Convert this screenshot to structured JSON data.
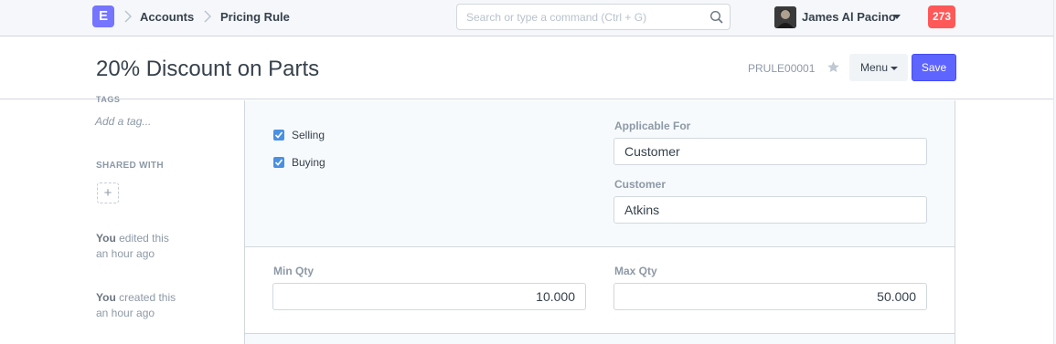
{
  "navbar": {
    "logo_letter": "E",
    "breadcrumbs": [
      "Accounts",
      "Pricing Rule"
    ],
    "search_placeholder": "Search or type a command (Ctrl + G)",
    "user_name": "James Al Pacino",
    "notification_count": "273"
  },
  "page_head": {
    "title": "20% Discount on Parts",
    "doc_name": "PRULE00001",
    "menu_label": "Menu",
    "save_label": "Save"
  },
  "sidebar": {
    "tags_label": "TAGS",
    "add_tag": "Add a tag...",
    "shared_with_label": "SHARED WITH",
    "share_add": "+",
    "activity": [
      {
        "actor": "You",
        "action": " edited this",
        "time": "an hour ago"
      },
      {
        "actor": "You",
        "action": " created this",
        "time": "an hour ago"
      }
    ]
  },
  "form": {
    "checkboxes": [
      {
        "label": "Selling",
        "checked": true
      },
      {
        "label": "Buying",
        "checked": true
      }
    ],
    "applicable_for": {
      "label": "Applicable For",
      "value": "Customer"
    },
    "customer": {
      "label": "Customer",
      "value": "Atkins"
    },
    "min_qty": {
      "label": "Min Qty",
      "value": "10.000"
    },
    "max_qty": {
      "label": "Max Qty",
      "value": "50.000"
    }
  },
  "colors": {
    "accent": "#5e64ff",
    "badge": "#ff5858",
    "logo": "#7575ff",
    "checkbox": "#4a90e2"
  }
}
